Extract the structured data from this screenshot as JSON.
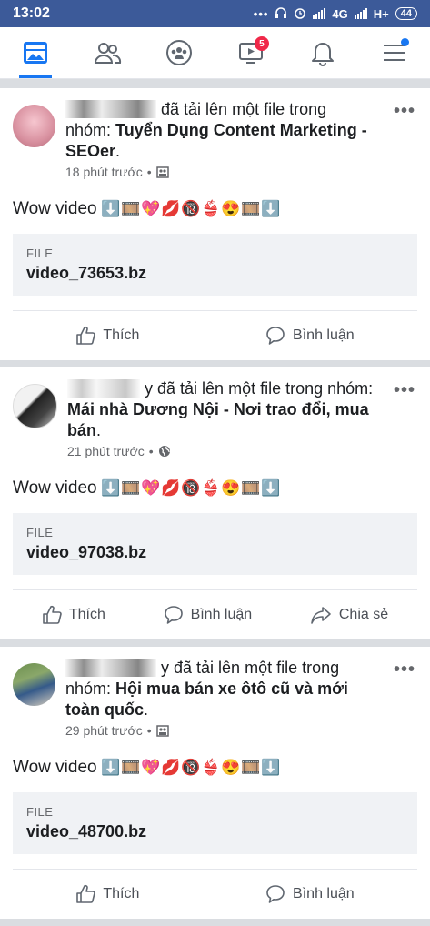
{
  "status_bar": {
    "time": "13:02",
    "network": "4G",
    "network2": "H+",
    "battery": "44"
  },
  "nav": {
    "items": [
      {
        "icon": "news-feed-icon",
        "active": true
      },
      {
        "icon": "friends-icon",
        "active": false
      },
      {
        "icon": "groups-icon",
        "active": false
      },
      {
        "icon": "watch-icon",
        "active": false,
        "badge": "5"
      },
      {
        "icon": "notifications-icon",
        "active": false
      },
      {
        "icon": "menu-icon",
        "active": false,
        "dot": true
      }
    ]
  },
  "posts": [
    {
      "author_suffix": "đã tải lên một file trong nhóm:",
      "group": "Tuyển Dụng Content Marketing - SEOer",
      "time": "18 phút trước",
      "visibility_icon": "group-privacy-icon",
      "text": "Wow video",
      "file_label": "FILE",
      "file_name": "video_73653.bz",
      "actions": [
        "Thích",
        "Bình luận"
      ]
    },
    {
      "author_suffix": "y đã tải lên một file trong nhóm:",
      "group": "Mái nhà Dương Nội - Nơi trao đổi, mua bán",
      "time": "21 phút trước",
      "visibility_icon": "globe-icon",
      "text": "Wow video",
      "file_label": "FILE",
      "file_name": "video_97038.bz",
      "actions": [
        "Thích",
        "Bình luận",
        "Chia sẻ"
      ]
    },
    {
      "author_suffix": "y đã tải lên một file trong nhóm:",
      "group": "Hội mua bán xe ôtô cũ và mới toàn quốc",
      "time": "29 phút trước",
      "visibility_icon": "group-privacy-icon",
      "text": "Wow video",
      "file_label": "FILE",
      "file_name": "video_48700.bz",
      "actions": [
        "Thích",
        "Bình luận"
      ]
    }
  ],
  "emoji": [
    "⬇️",
    "🎞️",
    "💖",
    "💋",
    "🔞",
    "👙",
    "😍",
    "🎞️",
    "⬇️"
  ],
  "colors": {
    "brand": "#3c5a99",
    "accent": "#1877f2",
    "badge": "#f02849"
  }
}
